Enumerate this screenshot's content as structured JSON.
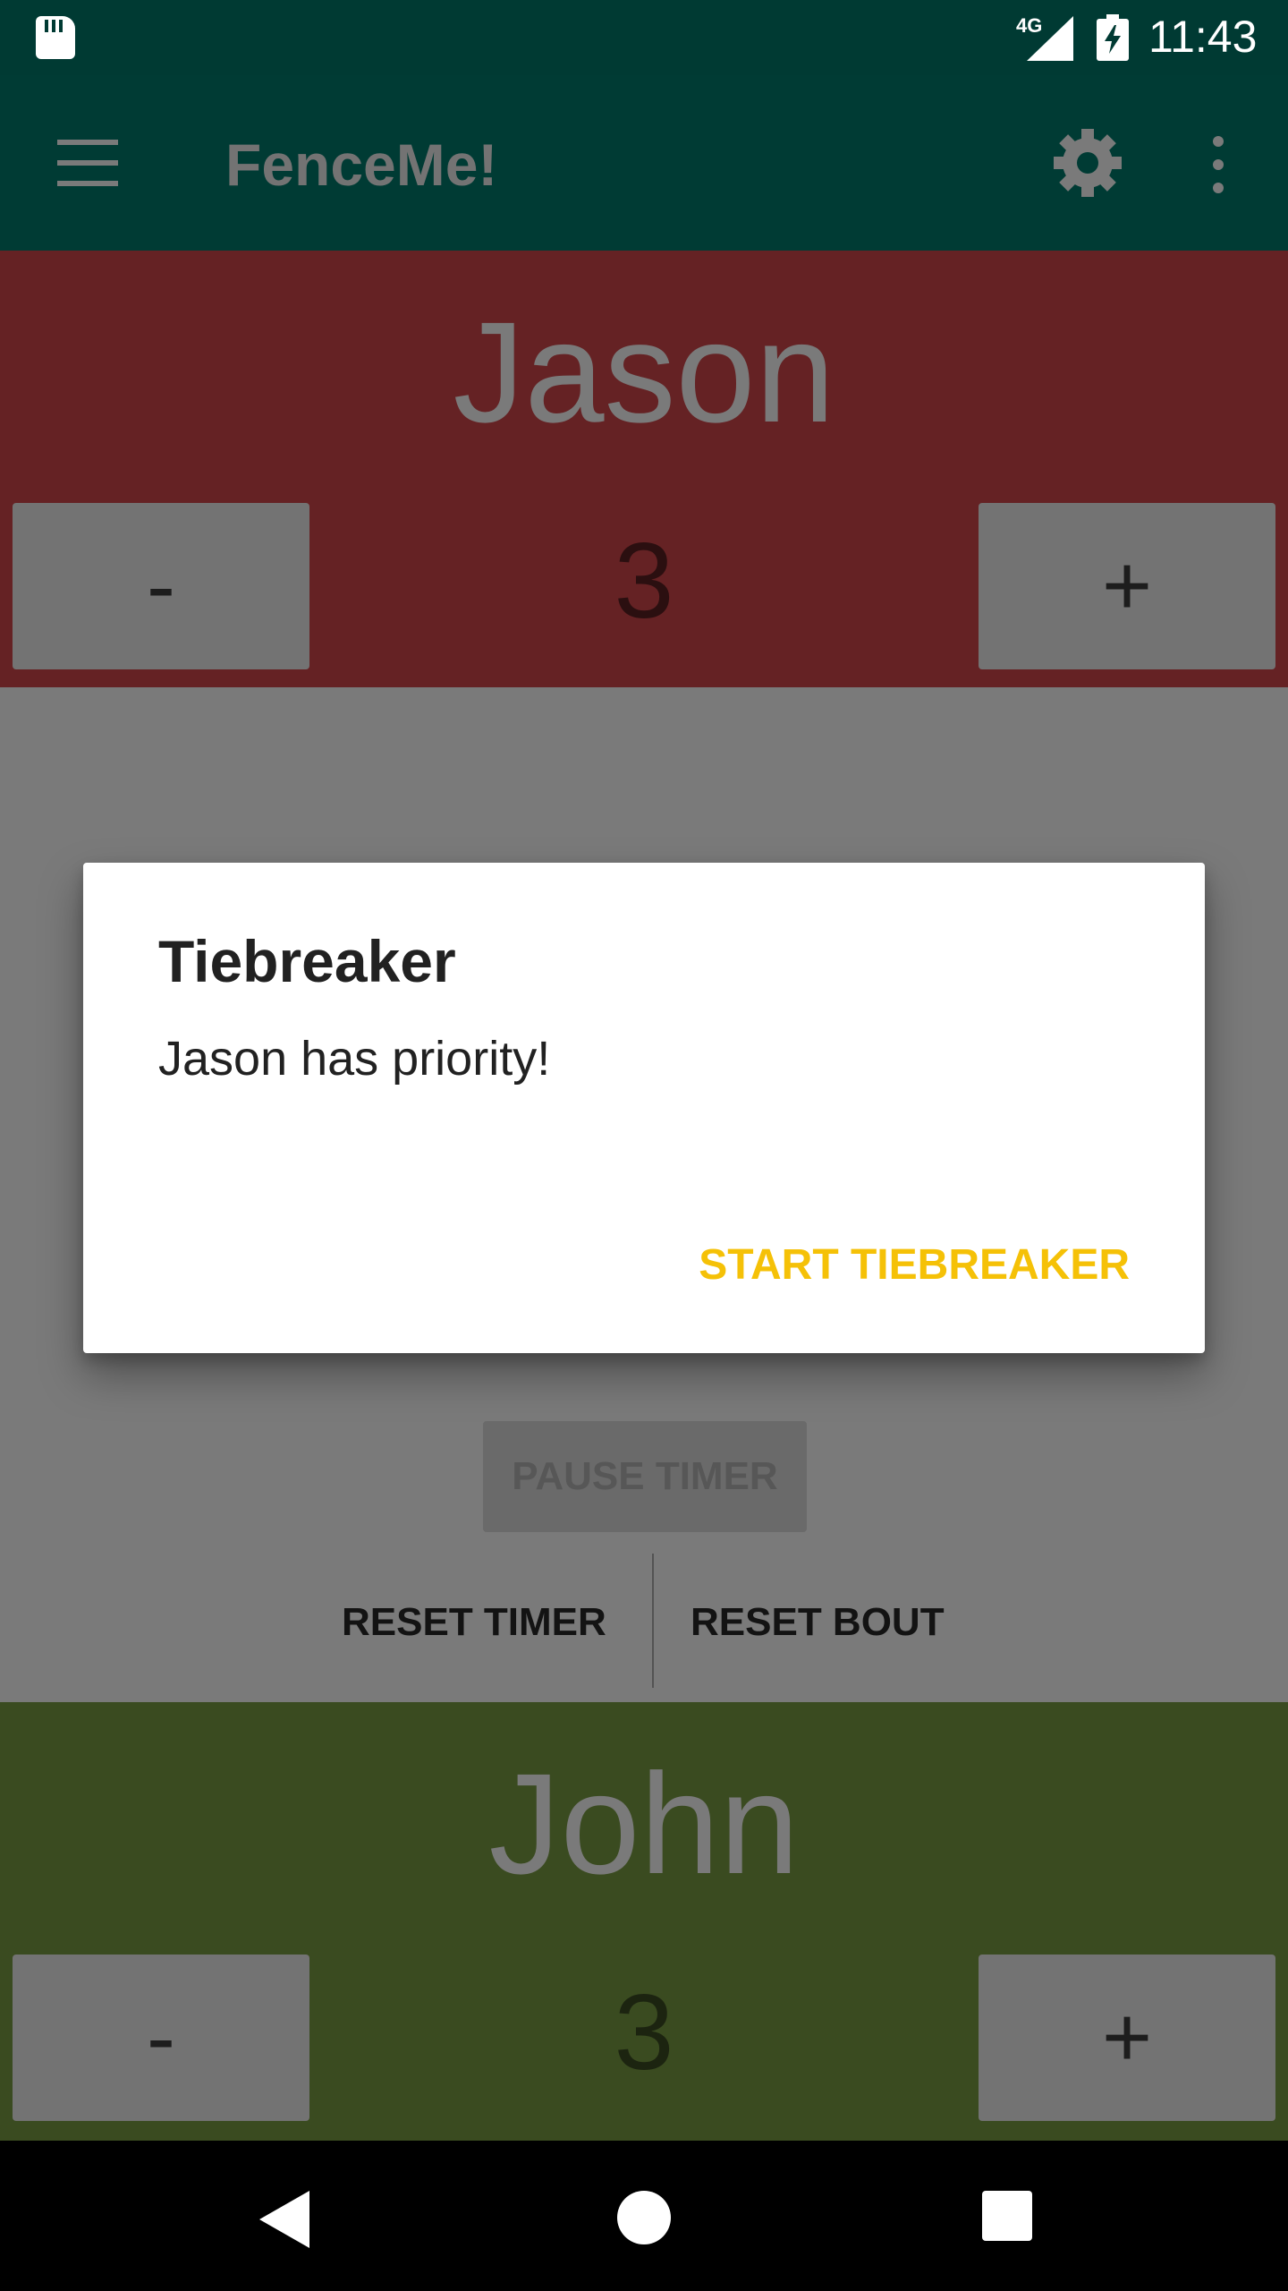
{
  "status_bar": {
    "network": "4G",
    "time": "11:43",
    "icons": [
      "sd-card-icon",
      "cell-signal-icon",
      "battery-charging-icon"
    ]
  },
  "app_bar": {
    "title": "FenceMe!",
    "icons": [
      "menu-icon",
      "settings-gear-icon",
      "overflow-menu-icon"
    ]
  },
  "top_player": {
    "name": "Jason",
    "score": "3",
    "minus_label": "-",
    "plus_label": "+",
    "color": "#652224"
  },
  "controls": {
    "pause_label": "PAUSE TIMER",
    "reset_timer_label": "RESET TIMER",
    "reset_bout_label": "RESET BOUT"
  },
  "bottom_player": {
    "name": "John",
    "score": "3",
    "minus_label": "-",
    "plus_label": "+",
    "color": "#3a4b20"
  },
  "dialog": {
    "title": "Tiebreaker",
    "message": "Jason has priority!",
    "action_label": "START TIEBREAKER",
    "action_color": "#f5c107"
  },
  "nav_bar": {
    "icons": [
      "back-icon",
      "home-icon",
      "recents-icon"
    ]
  }
}
